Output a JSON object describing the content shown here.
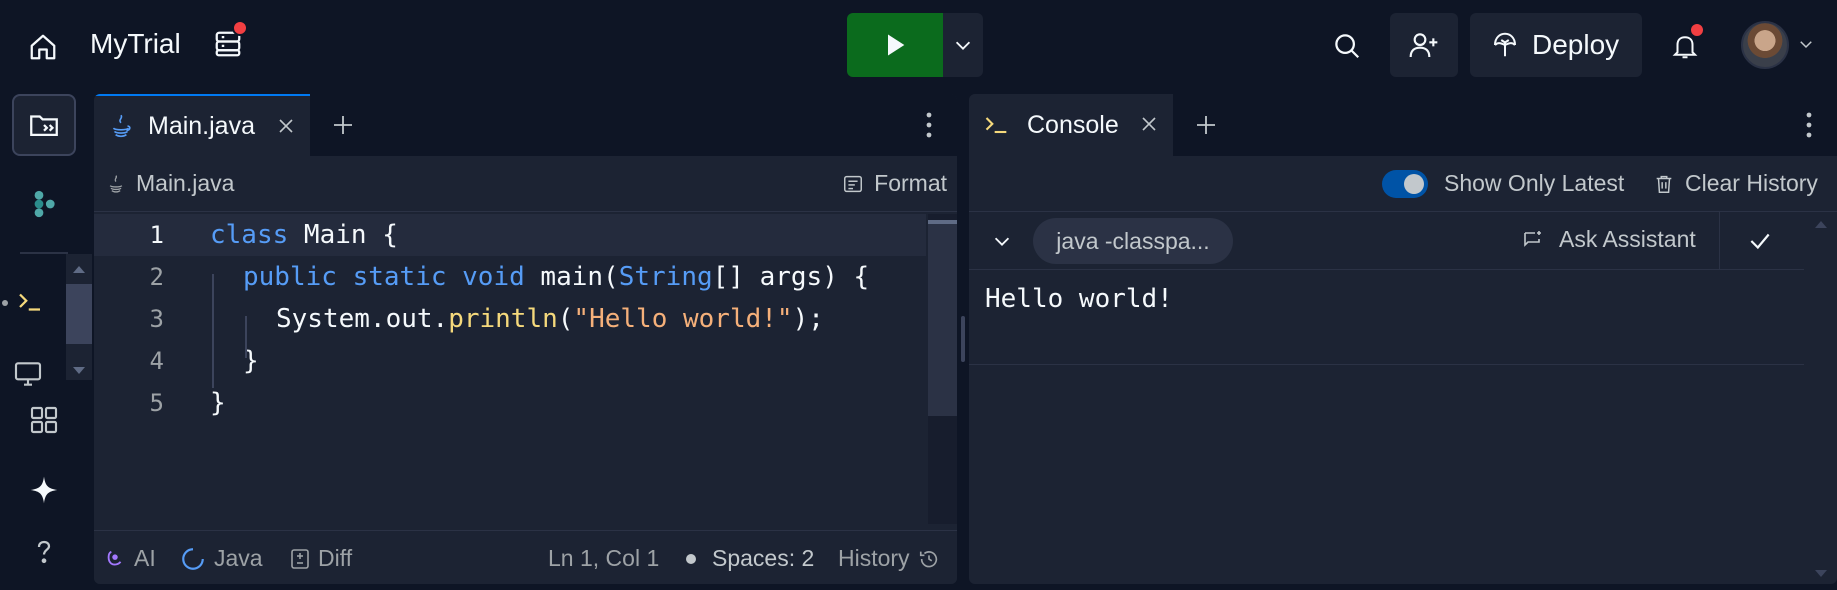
{
  "header": {
    "app_title": "MyTrial",
    "deploy_label": "Deploy",
    "icons": [
      "home-icon",
      "database-icon",
      "play-icon",
      "chevron-down-icon",
      "search-icon",
      "add-user-icon",
      "deploy-icon",
      "bell-icon",
      "avatar"
    ],
    "colors": {
      "run": "#0b6b1d",
      "notification": "#f23f42",
      "accent": "#0079f2"
    }
  },
  "editor": {
    "tab_label": "Main.java",
    "path_label": "Main.java",
    "format_label": "Format",
    "lines": [
      {
        "num": "1",
        "tokens": [
          {
            "t": "class",
            "c": "kw"
          },
          {
            "t": " Main {",
            "c": "pl"
          }
        ]
      },
      {
        "num": "2",
        "tokens": [
          {
            "t": "public",
            "c": "kw"
          },
          {
            "t": " ",
            "c": "pl"
          },
          {
            "t": "static",
            "c": "kw"
          },
          {
            "t": " ",
            "c": "pl"
          },
          {
            "t": "void",
            "c": "kw"
          },
          {
            "t": " main(",
            "c": "pl"
          },
          {
            "t": "String",
            "c": "kw"
          },
          {
            "t": "[] args) {",
            "c": "pl"
          }
        ]
      },
      {
        "num": "3",
        "tokens": [
          {
            "t": "System.out.",
            "c": "pl"
          },
          {
            "t": "println",
            "c": "fn"
          },
          {
            "t": "(",
            "c": "pl"
          },
          {
            "t": "\"Hello world!\"",
            "c": "str"
          },
          {
            "t": ");",
            "c": "pl"
          }
        ]
      },
      {
        "num": "4",
        "tokens": [
          {
            "t": "}",
            "c": "pl"
          }
        ]
      },
      {
        "num": "5",
        "tokens": [
          {
            "t": "}",
            "c": "pl"
          }
        ]
      }
    ],
    "status": {
      "ai": "AI",
      "language": "Java",
      "diff": "Diff",
      "cursor": "Ln 1, Col 1",
      "spaces": "Spaces: 2",
      "history": "History"
    }
  },
  "console": {
    "tab_label": "Console",
    "show_latest_label": "Show Only Latest",
    "show_latest_on": true,
    "clear_history_label": "Clear History",
    "command_chip": "java -classpa...",
    "ask_assistant_label": "Ask Assistant",
    "output": "Hello world!"
  }
}
